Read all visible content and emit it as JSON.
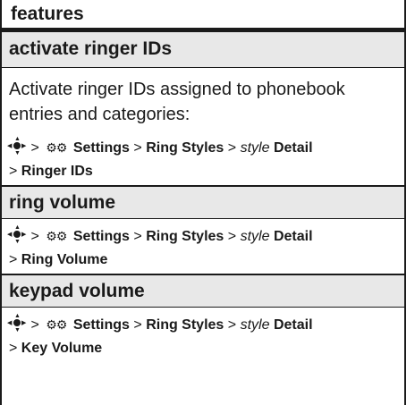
{
  "header": {
    "title": "features"
  },
  "sections": [
    {
      "title": "activate ringer IDs",
      "description": "Activate ringer IDs assigned to phonebook entries and categories:",
      "path_line1": {
        "settings": "Settings",
        "ring_styles": "Ring Styles",
        "style": "style",
        "detail": "Detail"
      },
      "path_line2": "Ringer IDs"
    },
    {
      "title": "ring volume",
      "path_line1": {
        "settings": "Settings",
        "ring_styles": "Ring Styles",
        "style": "style",
        "detail": "Detail"
      },
      "path_line2": "Ring Volume"
    },
    {
      "title": "keypad volume",
      "path_line1": {
        "settings": "Settings",
        "ring_styles": "Ring Styles",
        "style": "style",
        "detail": "Detail"
      },
      "path_line2": "Key Volume"
    }
  ],
  "separator": ">"
}
